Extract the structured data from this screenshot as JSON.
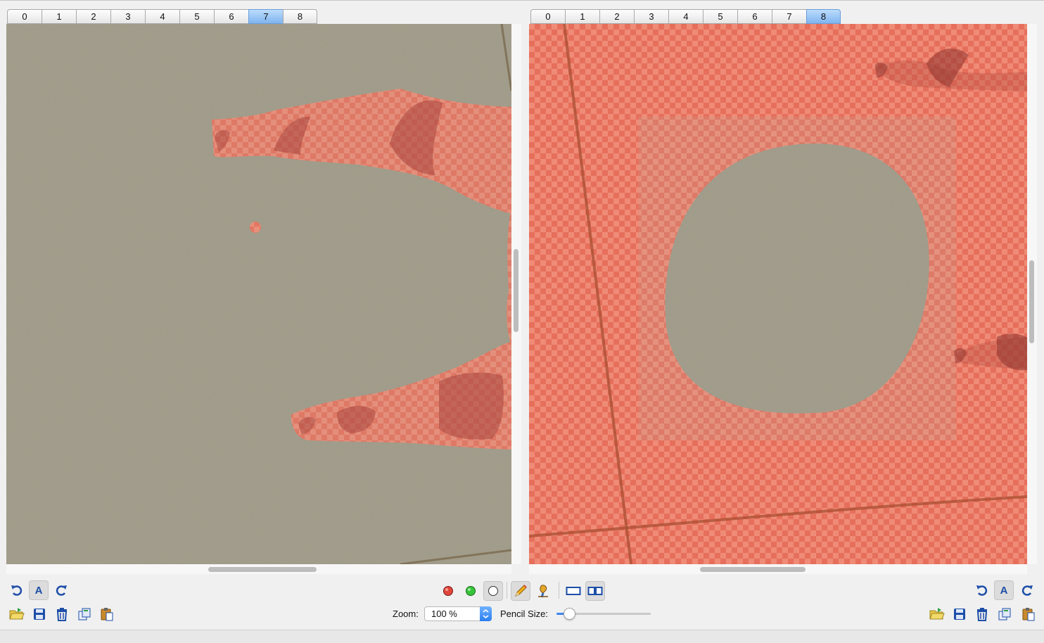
{
  "left_tabs": [
    {
      "label": "0"
    },
    {
      "label": "1"
    },
    {
      "label": "2"
    },
    {
      "label": "3"
    },
    {
      "label": "4"
    },
    {
      "label": "5"
    },
    {
      "label": "6"
    },
    {
      "label": "7",
      "active": true
    },
    {
      "label": "8"
    }
  ],
  "right_tabs": [
    {
      "label": "0"
    },
    {
      "label": "1"
    },
    {
      "label": "2"
    },
    {
      "label": "3"
    },
    {
      "label": "4"
    },
    {
      "label": "5"
    },
    {
      "label": "6"
    },
    {
      "label": "7"
    },
    {
      "label": "8",
      "active": true
    }
  ],
  "toolbar": {
    "zoom_label": "Zoom:",
    "zoom_value": "100 %",
    "pencil_size_label": "Pencil Size:",
    "pencil_size_fraction": 0.1,
    "auto_button_label": "A",
    "icons": [
      "undo-icon",
      "auto-icon",
      "redo-icon",
      "open-folder-icon",
      "save-icon",
      "trash-icon",
      "copy-icon",
      "paste-icon",
      "red-dot-icon",
      "green-dot-icon",
      "empty-dot-icon",
      "pencil-icon",
      "fill-brush-icon",
      "single-view-icon",
      "dual-view-icon"
    ]
  },
  "colors": {
    "mask": "#e8604f",
    "floor": "#9d9886",
    "active_tab": "#7fb4ef",
    "accent": "#2a7ff0",
    "icon_blue": "#1d4ea8"
  }
}
